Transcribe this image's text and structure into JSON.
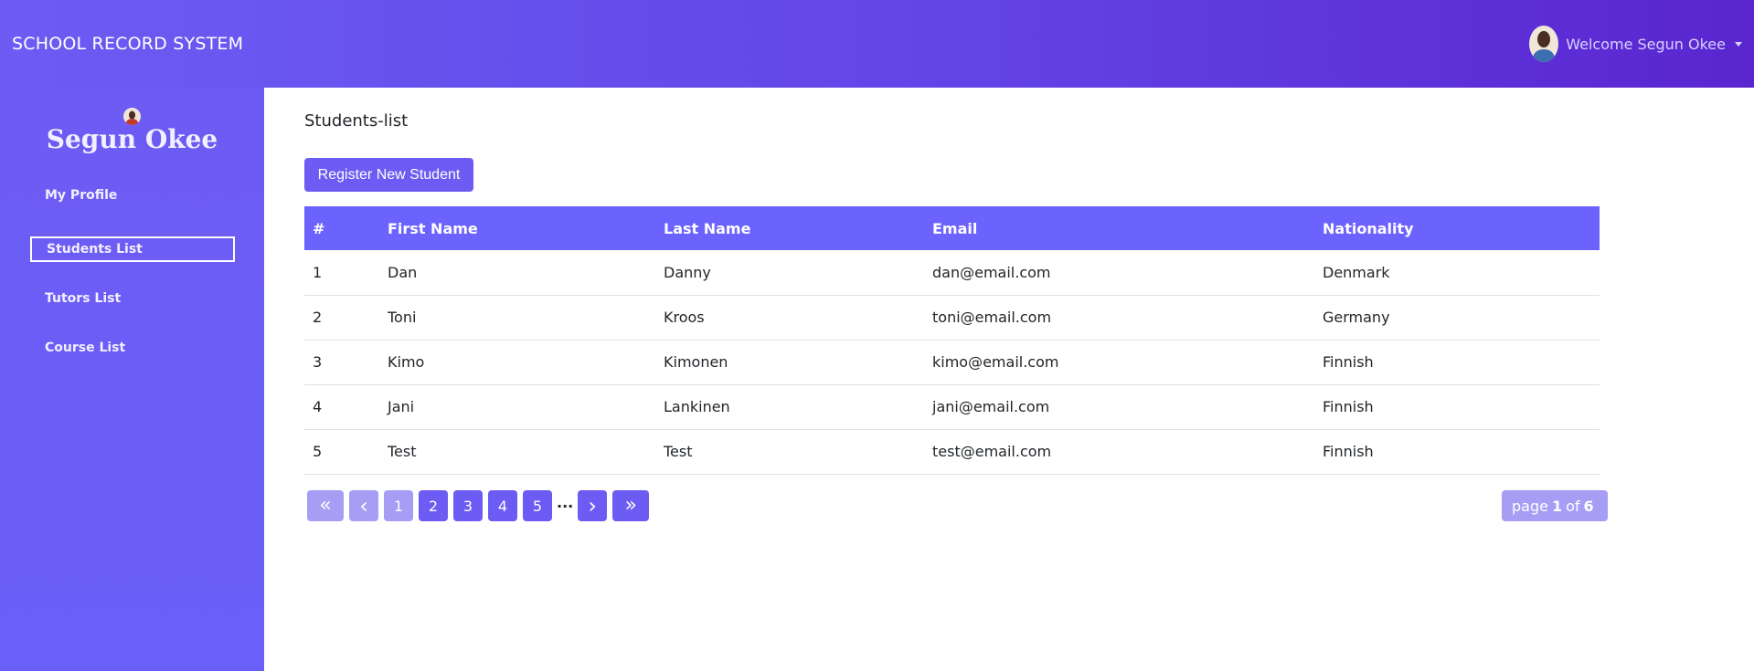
{
  "header": {
    "brand": "SCHOOL RECORD SYSTEM",
    "welcome": "Welcome Segun Okee"
  },
  "sidebar": {
    "name": "Segun Okee",
    "items": [
      {
        "label": "My Profile"
      },
      {
        "label": "Students List",
        "active": true
      },
      {
        "label": "Tutors List"
      },
      {
        "label": "Course List"
      }
    ]
  },
  "main": {
    "title": "Students-list",
    "register_button": "Register New Student",
    "table": {
      "headers": [
        "#",
        "First Name",
        "Last Name",
        "Email",
        "Nationality"
      ],
      "rows": [
        [
          "1",
          "Dan",
          "Danny",
          "dan@email.com",
          "Denmark"
        ],
        [
          "2",
          "Toni",
          "Kroos",
          "toni@email.com",
          "Germany"
        ],
        [
          "3",
          "Kimo",
          "Kimonen",
          "kimo@email.com",
          "Finnish"
        ],
        [
          "4",
          "Jani",
          "Lankinen",
          "jani@email.com",
          "Finnish"
        ],
        [
          "5",
          "Test",
          "Test",
          "test@email.com",
          "Finnish"
        ]
      ]
    },
    "pagination": {
      "first": "«",
      "prev": "‹",
      "pages": [
        "1",
        "2",
        "3",
        "4",
        "5"
      ],
      "ellipsis": "···",
      "next": "›",
      "last": "»",
      "current": "1",
      "info_prefix": "page",
      "info_current": "1",
      "info_sep": "of",
      "info_total": "6"
    }
  },
  "colors": {
    "accent": "#6c5cf3",
    "header_end": "#5a25cf",
    "table_header": "#6c63ff",
    "disabled": "#a79df5"
  }
}
